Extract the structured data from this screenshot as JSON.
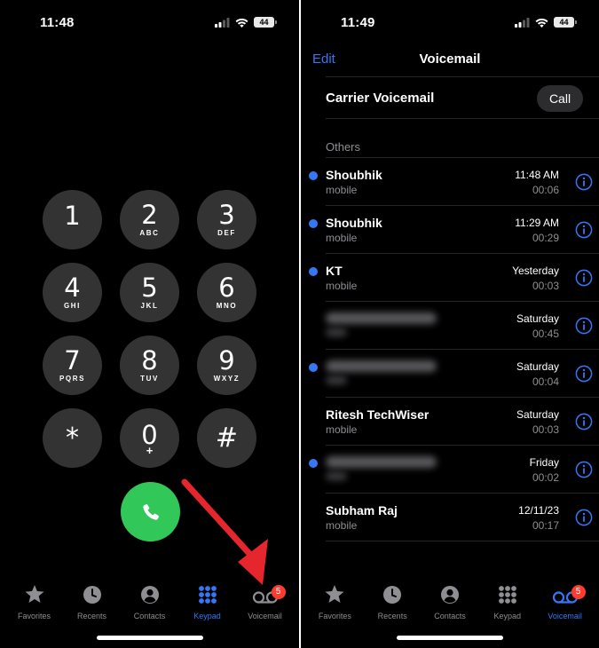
{
  "colors": {
    "accent": "#3478f6",
    "call_green": "#31c759",
    "badge_red": "#ff3b30",
    "key_gray": "#333333",
    "secondary_text": "#8e8e93"
  },
  "left": {
    "status": {
      "time": "11:48",
      "battery": "44"
    },
    "keys": [
      {
        "digit": "1",
        "letters": ""
      },
      {
        "digit": "2",
        "letters": "ABC"
      },
      {
        "digit": "3",
        "letters": "DEF"
      },
      {
        "digit": "4",
        "letters": "GHI"
      },
      {
        "digit": "5",
        "letters": "JKL"
      },
      {
        "digit": "6",
        "letters": "MNO"
      },
      {
        "digit": "7",
        "letters": "PQRS"
      },
      {
        "digit": "8",
        "letters": "TUV"
      },
      {
        "digit": "9",
        "letters": "WXYZ"
      },
      {
        "digit": "*",
        "letters": ""
      },
      {
        "digit": "0",
        "letters": "+"
      },
      {
        "digit": "#",
        "letters": ""
      }
    ],
    "tabs": [
      {
        "label": "Favorites",
        "icon": "star-icon"
      },
      {
        "label": "Recents",
        "icon": "clock-icon"
      },
      {
        "label": "Contacts",
        "icon": "person-icon"
      },
      {
        "label": "Keypad",
        "icon": "keypad-icon",
        "active": true
      },
      {
        "label": "Voicemail",
        "icon": "voicemail-icon",
        "badge": "5"
      }
    ]
  },
  "right": {
    "status": {
      "time": "11:49",
      "battery": "44"
    },
    "nav": {
      "edit": "Edit",
      "title": "Voicemail"
    },
    "carrier": {
      "label": "Carrier Voicemail",
      "call_label": "Call"
    },
    "section": "Others",
    "voicemails": [
      {
        "name": "Shoubhik",
        "sub": "mobile",
        "time": "11:48 AM",
        "duration": "00:06",
        "unread": true
      },
      {
        "name": "Shoubhik",
        "sub": "mobile",
        "time": "11:29 AM",
        "duration": "00:29",
        "unread": true
      },
      {
        "name": "KT",
        "sub": "mobile",
        "time": "Yesterday",
        "duration": "00:03",
        "unread": true
      },
      {
        "name": "",
        "sub": "",
        "time": "Saturday",
        "duration": "00:45",
        "unread": false,
        "blurred": true
      },
      {
        "name": "",
        "sub": "",
        "time": "Saturday",
        "duration": "00:04",
        "unread": true,
        "blurred": true
      },
      {
        "name": "Ritesh TechWiser",
        "sub": "mobile",
        "time": "Saturday",
        "duration": "00:03",
        "unread": false
      },
      {
        "name": "",
        "sub": "",
        "time": "Friday",
        "duration": "00:02",
        "unread": true,
        "blurred": true
      },
      {
        "name": "Subham Raj",
        "sub": "mobile",
        "time": "12/11/23",
        "duration": "00:17",
        "unread": false
      }
    ],
    "tabs": [
      {
        "label": "Favorites",
        "icon": "star-icon"
      },
      {
        "label": "Recents",
        "icon": "clock-icon"
      },
      {
        "label": "Contacts",
        "icon": "person-icon"
      },
      {
        "label": "Keypad",
        "icon": "keypad-icon"
      },
      {
        "label": "Voicemail",
        "icon": "voicemail-icon",
        "active": true,
        "badge": "5"
      }
    ]
  }
}
